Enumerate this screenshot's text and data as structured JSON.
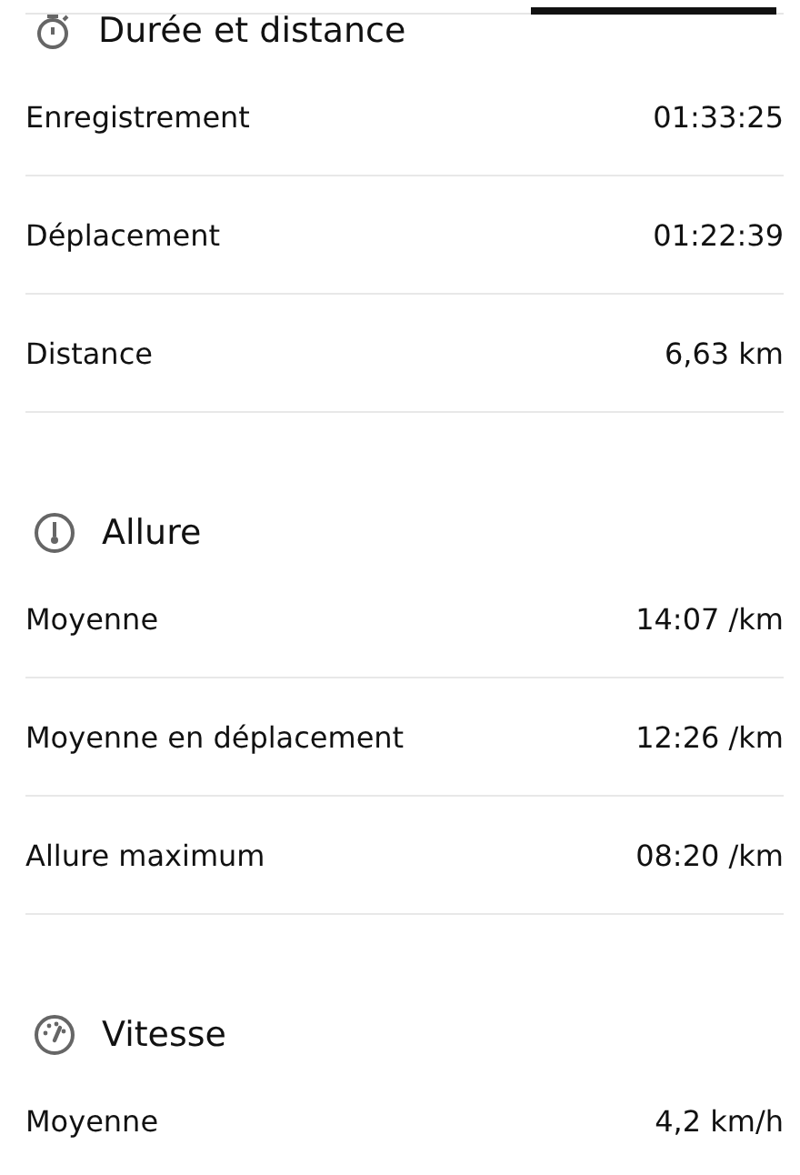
{
  "sections": [
    {
      "title": "Durée et distance",
      "kind": "stopwatch",
      "rows": [
        {
          "label": "Enregistrement",
          "value": "01:33:25"
        },
        {
          "label": "Déplacement",
          "value": "01:22:39"
        },
        {
          "label": "Distance",
          "value": "6,63 km"
        }
      ]
    },
    {
      "title": "Allure",
      "kind": "thermometer",
      "rows": [
        {
          "label": "Moyenne",
          "value": "14:07 /km"
        },
        {
          "label": "Moyenne en déplacement",
          "value": "12:26 /km"
        },
        {
          "label": "Allure maximum",
          "value": "08:20 /km"
        }
      ]
    },
    {
      "title": "Vitesse",
      "kind": "gauge",
      "rows": [
        {
          "label": "Moyenne",
          "value": "4,2 km/h"
        }
      ]
    }
  ]
}
